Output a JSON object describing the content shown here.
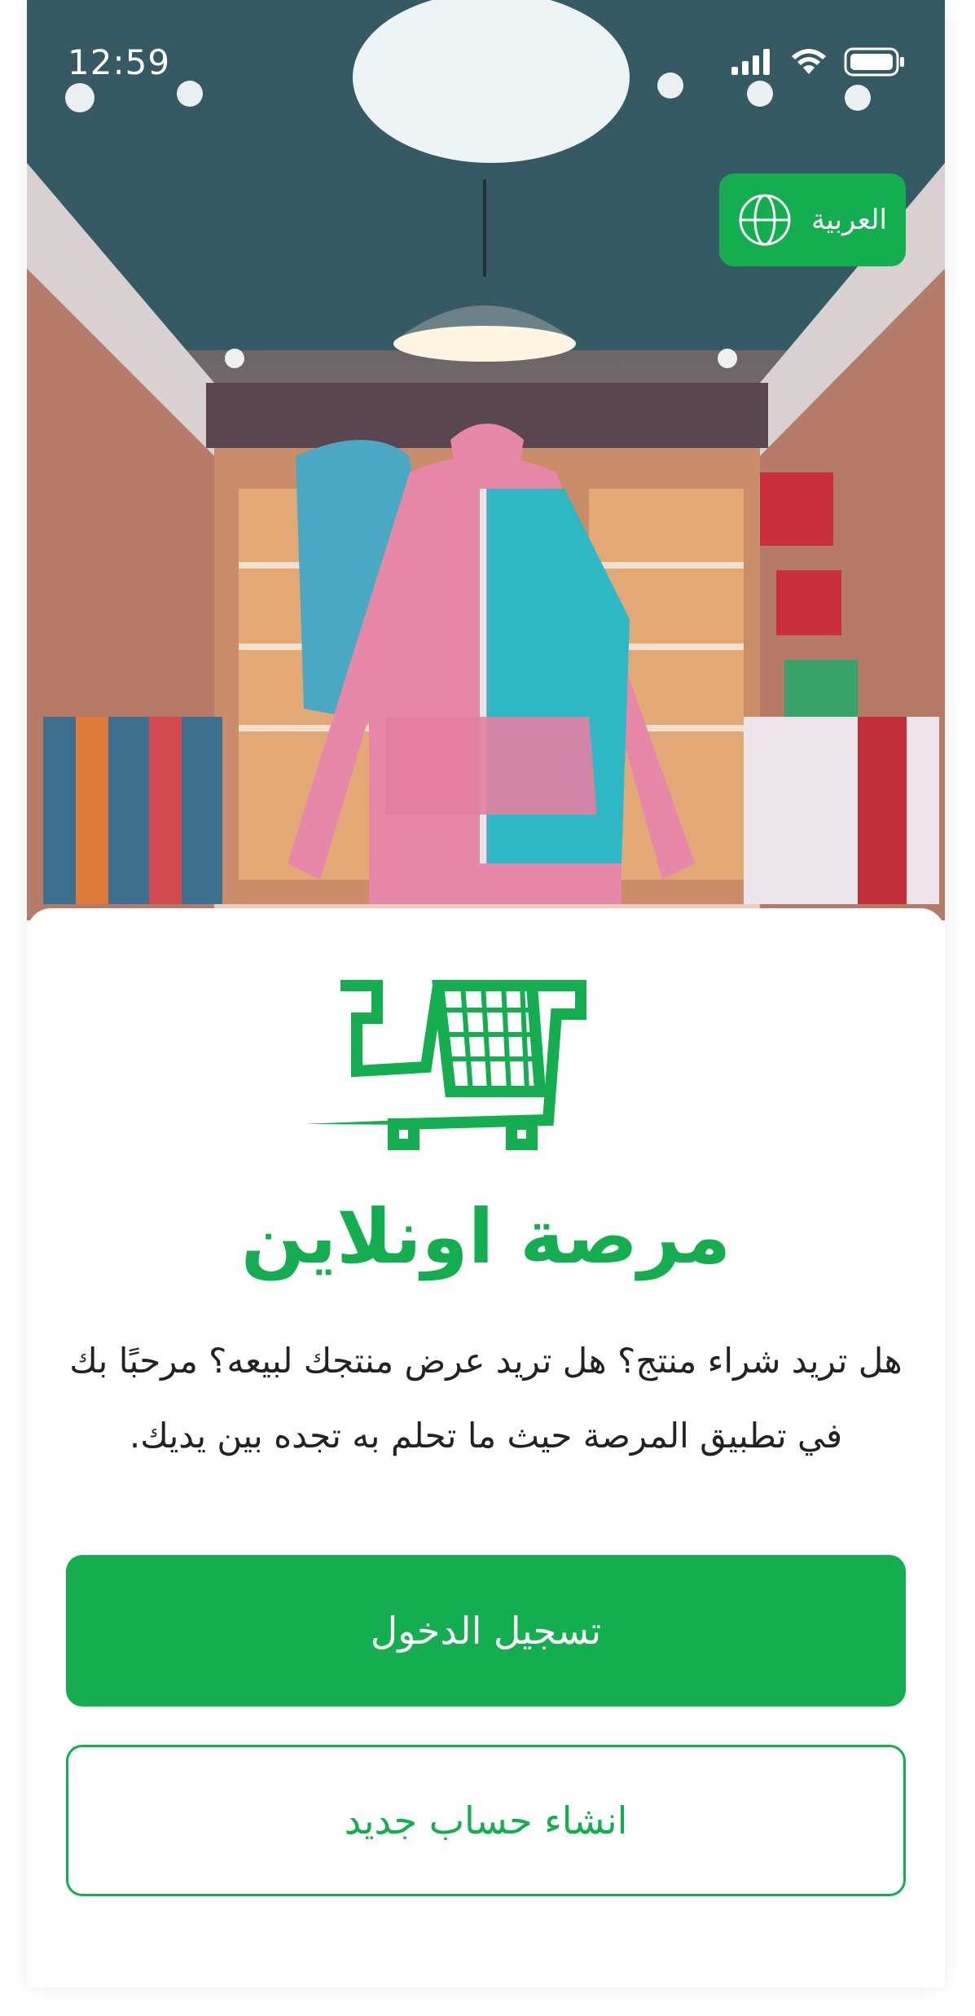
{
  "status_bar": {
    "time": "12:59"
  },
  "language_button": {
    "label": "العربية",
    "icon": "globe-icon"
  },
  "brand": {
    "name": "مرصة اونلاين",
    "logo": "shopping-cart-logo"
  },
  "welcome": {
    "text": "هل تريد شراء منتج؟ هل تريد عرض منتجك لبيعه؟ مرحبًا بك في تطبيق المرصة حيث ما تحلم به تجده بين يديك."
  },
  "actions": {
    "login_label": "تسجيل الدخول",
    "register_label": "انشاء حساب جديد"
  },
  "colors": {
    "accent": "#14ad4f",
    "text": "#222222",
    "background": "#ffffff"
  }
}
